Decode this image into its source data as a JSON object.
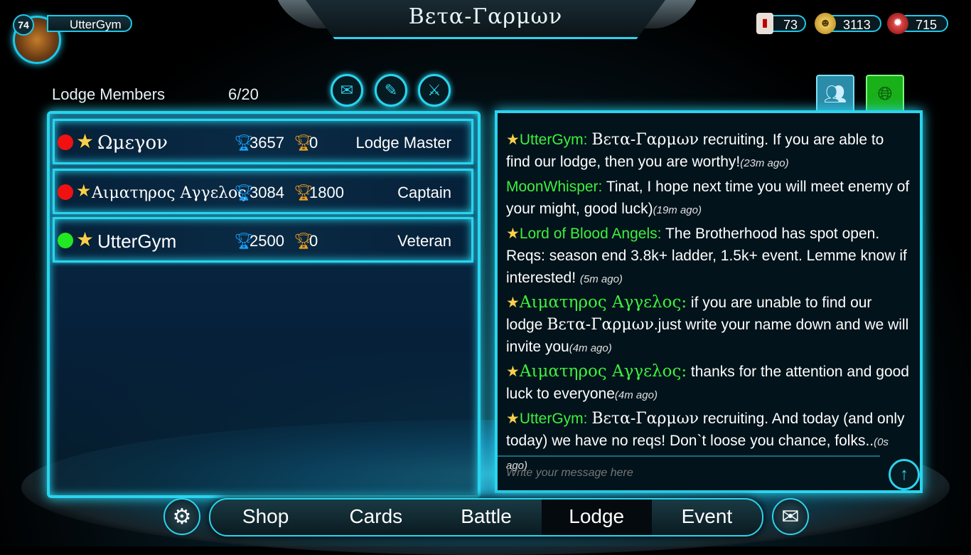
{
  "header": {
    "title": "Βετα-Γαρμων",
    "player": {
      "level": "74",
      "name": "UtterGym"
    },
    "currencies": [
      {
        "icon": "card-pack-icon",
        "value": "73"
      },
      {
        "icon": "gold-coin-icon",
        "value": "3113"
      },
      {
        "icon": "red-gem-icon",
        "value": "715"
      }
    ]
  },
  "members": {
    "label": "Lodge Members",
    "count": "6/20",
    "actions": [
      "mail-icon",
      "edit-pencil-icon",
      "crossed-swords-icon"
    ],
    "rows": [
      {
        "status": "offline",
        "name": "Ωμεγον",
        "trophies": "3657",
        "event_trophies": "0",
        "rank": "Lodge Master"
      },
      {
        "status": "offline",
        "name": "Αιματηρος Αγγελος",
        "trophies": "3084",
        "event_trophies": "1800",
        "rank": "Captain"
      },
      {
        "status": "online",
        "name": "UtterGym",
        "trophies": "2500",
        "event_trophies": "0",
        "rank": "Veteran"
      }
    ]
  },
  "chat": {
    "tabs": [
      "group-chat-icon",
      "global-chat-icon"
    ],
    "messages": [
      {
        "sender": "UtterGym:",
        "lodge": "Βετα-Γαρμων",
        "text": " recruiting. If you are able to find our lodge, then you are worthy!",
        "ago": "(23m ago)"
      },
      {
        "sender": "MoonWhisper:",
        "lodge": "",
        "text": " Tinat, I hope next time you will meet enemy of your might, good luck)",
        "ago": "(19m ago)"
      },
      {
        "sender": "Lord of Blood Angels:",
        "lodge": "",
        "text": " The Brotherhood has spot open. Reqs: season end 3.8k+ ladder, 1.5k+ event. Lemme know if interested!",
        "ago": "(5m ago)"
      },
      {
        "sender": "Αιματηρος Αγγελος:",
        "lodge": "",
        "text": " if you are unable to find our lodge ",
        "lodge2": "Βετα-Γαρμων",
        "text2": ".just write your name down and we will invite you",
        "ago": "(4m ago)"
      },
      {
        "sender": "Αιματηρος Αγγελος:",
        "lodge": "",
        "text": " thanks for the attention and good luck to everyone",
        "ago": "(4m ago)"
      },
      {
        "sender": "UtterGym:",
        "lodge": "Βετα-Γαρμων",
        "text": " recruiting. And today (and only today) we have no reqs! Don`t loose you chance, folks..",
        "ago": "(0s ago)"
      }
    ],
    "input_placeholder": "Write your message here"
  },
  "nav": {
    "items": [
      "Shop",
      "Cards",
      "Battle",
      "Lodge",
      "Event"
    ],
    "active": "Lodge"
  },
  "colors": {
    "accent": "#2ad4ee",
    "sender": "#3ef03e",
    "offline": "#f21111",
    "online": "#22e822"
  }
}
